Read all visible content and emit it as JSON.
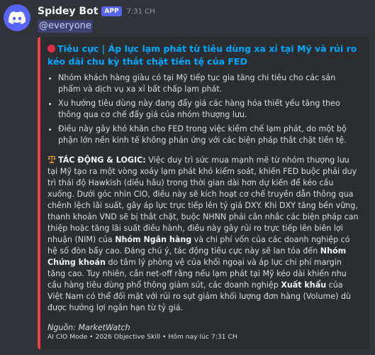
{
  "author": {
    "name": "Spidey Bot",
    "badge": "APP",
    "timestamp": "7:31 CH",
    "avatar_icon": "discord-logo-icon"
  },
  "message": {
    "mention": "@everyone"
  },
  "embed": {
    "accent_color": "#ed4245",
    "title_icon": "red-circle-icon",
    "title": "Tiêu cực | Áp lực lạm phát từ tiêu dùng xa xỉ tại Mỹ và rủi ro kéo dài chu kỳ thắt chặt tiền tệ của FED",
    "bullets": [
      "Nhóm khách hàng giàu có tại Mỹ tiếp tục gia tăng chi tiêu cho các sản phẩm và dịch vụ xa xỉ bất chấp lạm phát.",
      "Xu hướng tiêu dùng này đang đẩy giá các hàng hóa thiết yếu tăng theo thông qua cơ chế đẩy giá của nhóm thượng lưu.",
      "Điều này gây khó khăn cho FED trong việc kiềm chế lạm phát, do một bộ phận lớn nền kinh tế không phản ứng với các biện pháp thắt chặt tiền tệ."
    ],
    "impact": {
      "icon": "balance-scale-icon",
      "heading": "TÁC ĐỘNG & LOGIC:",
      "text1": " Việc duy trì sức mua mạnh mẽ từ nhóm thượng lưu tại Mỹ tạo ra một vòng xoáy lạm phát khó kiểm soát, khiến FED buộc phải duy trì thái độ Hawkish (diều hâu) trong thời gian dài hơn dự kiến để kéo cầu xuống. Dưới góc nhìn CIO, điều này sẽ kích hoạt cơ chế truyền dẫn thông qua chênh lệch lãi suất, gây áp lực trực tiếp lên tỷ giá DXY. Khi DXY tăng bền vững, thanh khoản VND sẽ bị thắt chặt, buộc NHNN phải cân nhắc các biện pháp can thiệp hoặc tăng lãi suất điều hành, điều này gây rủi ro trực tiếp lên biên lợi nhuận (NIM) của ",
      "bold1": "Nhóm Ngân hàng",
      "text2": " và chi phí vốn của các doanh nghiệp có hệ số đòn bẩy cao. Đáng chú ý, tác động tiêu cực này sẽ lan tỏa đến ",
      "bold2": "Nhóm Chứng khoán",
      "text3": " do tâm lý phòng vệ của khối ngoại và áp lực chi phí margin tăng cao. Tuy nhiên, cần net-off rằng nếu lạm phát tại Mỹ kéo dài khiến nhu cầu hàng tiêu dùng phổ thông giảm sút, các doanh nghiệp ",
      "bold3": "Xuất khẩu",
      "text4": " của Việt Nam có thể đối mặt với rủi ro sụt giảm khối lượng đơn hàng (Volume) dù được hưởng lợi ngắn hạn từ tỷ giá."
    },
    "source": "Nguồn: MarketWatch",
    "footer": "AI CIO Mode • 2026 Objective Skill • Hôm nay lúc 7:31 CH"
  }
}
